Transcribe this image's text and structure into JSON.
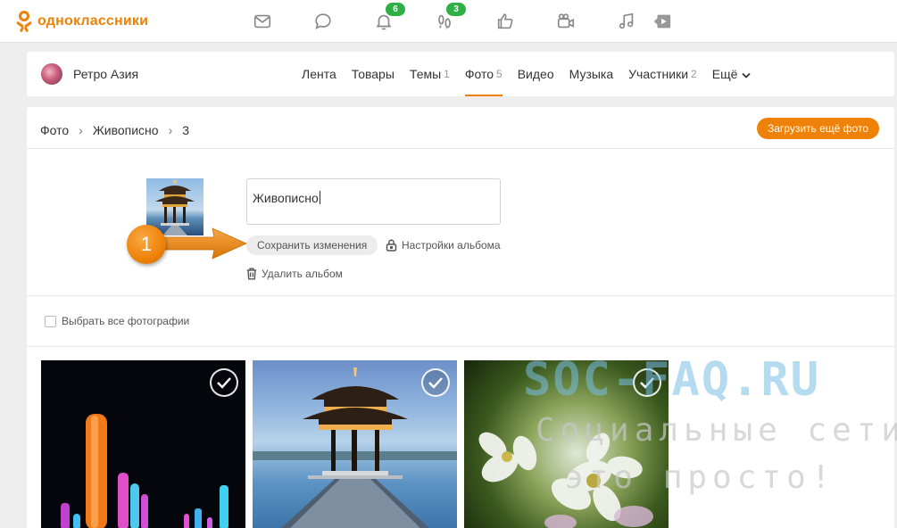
{
  "topbar": {
    "logo_text": "одноклассники",
    "brand_color": "#ee8208",
    "badge_color": "#2fb045",
    "icons": [
      {
        "name": "messages-icon"
      },
      {
        "name": "discussions-icon"
      },
      {
        "name": "notifications-icon",
        "badge": "6"
      },
      {
        "name": "guests-icon",
        "badge": "3"
      },
      {
        "name": "marks-icon"
      },
      {
        "name": "video-icon"
      },
      {
        "name": "music-icon"
      },
      {
        "name": "video-play-icon"
      }
    ]
  },
  "group": {
    "name": "Ретро Азия",
    "tabs": [
      {
        "label": "Лента",
        "count": ""
      },
      {
        "label": "Товары",
        "count": ""
      },
      {
        "label": "Темы",
        "count": "1"
      },
      {
        "label": "Фото",
        "count": "5",
        "active": true
      },
      {
        "label": "Видео",
        "count": ""
      },
      {
        "label": "Музыка",
        "count": ""
      },
      {
        "label": "Участники",
        "count": "2"
      },
      {
        "label": "Ещё",
        "count": ""
      }
    ]
  },
  "album": {
    "breadcrumb": [
      "Фото",
      "Живописно",
      "3"
    ],
    "upload_label": "Загрузить ещё фото",
    "title_value": "Живописно",
    "save_label": "Сохранить изменения",
    "settings_label": "Настройки альбома",
    "delete_label": "Удалить альбом",
    "select_all_label": "Выбрать все фотографии"
  },
  "annotation": {
    "step_number": "1"
  },
  "watermark": {
    "main": "SOC-FAQ.RU",
    "line1": "Социальные сети",
    "line2": "это просто!"
  }
}
